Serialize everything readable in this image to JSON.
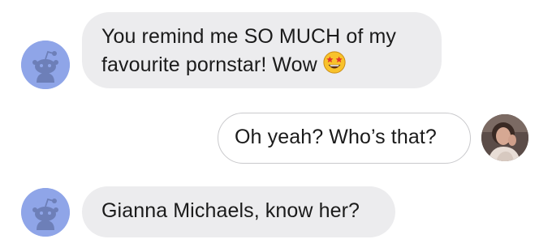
{
  "conversation": {
    "messages": [
      {
        "sender": "other",
        "avatar": "snoo-avatar-icon",
        "lines": [
          "You remind me SO MUCH of my",
          "favourite pornstar! Wow"
        ],
        "emoji": "star-struck-emoji-icon"
      },
      {
        "sender": "self",
        "avatar": "profile-photo",
        "lines": [
          "Oh yeah? Who’s that?"
        ]
      },
      {
        "sender": "other",
        "avatar": "snoo-avatar-icon",
        "lines": [
          "Gianna Michaels, know her?"
        ]
      }
    ]
  },
  "colors": {
    "incoming_bubble": "#ececee",
    "outgoing_bubble_border": "#c9c9cc",
    "snoo_avatar": "#8fa5e8",
    "text": "#1b1b1b"
  }
}
